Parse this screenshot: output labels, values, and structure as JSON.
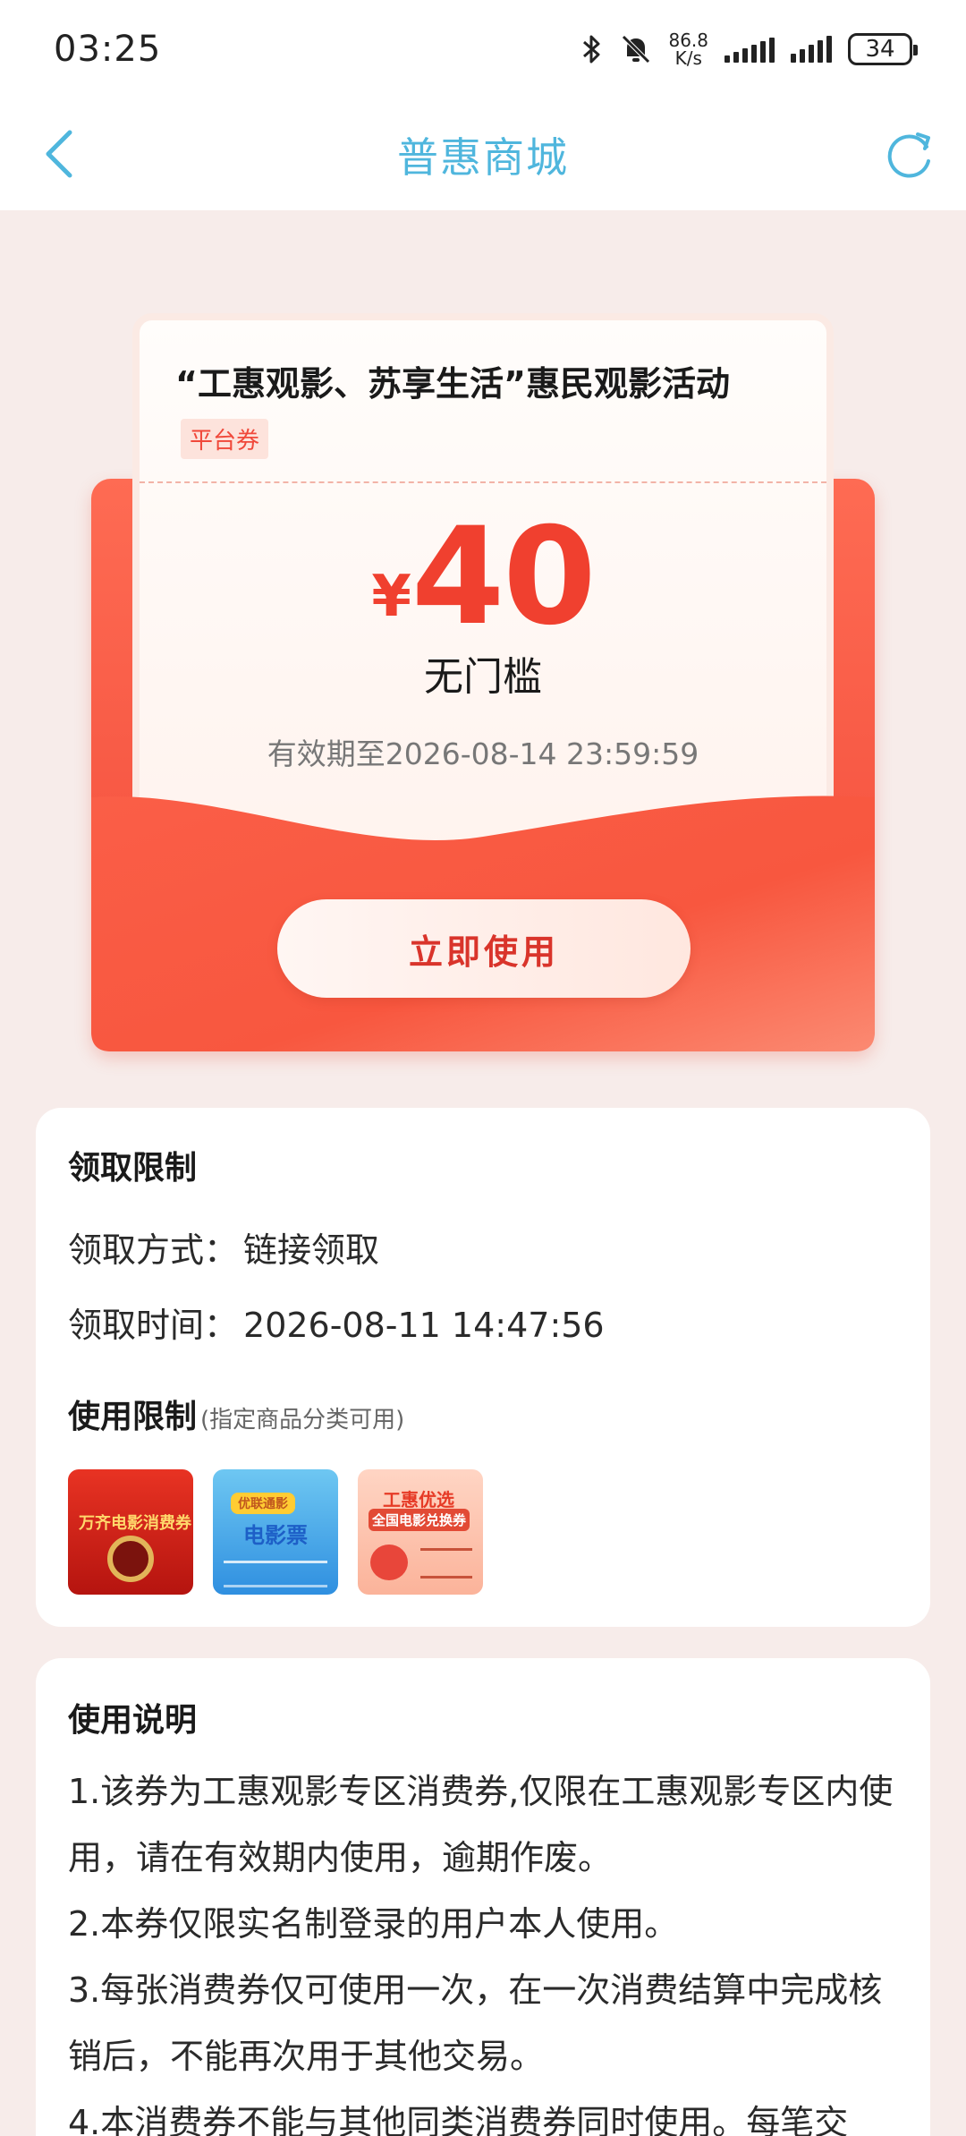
{
  "status_bar": {
    "time": "03:25",
    "net_speed_value": "86.8",
    "net_speed_unit": "K/s",
    "battery": "34"
  },
  "nav": {
    "title": "普惠商城",
    "back_icon": "chevron-left-icon",
    "refresh_icon": "refresh-icon",
    "accent_color": "#4fb6dd"
  },
  "coupon": {
    "title": "“工惠观影、苏享生活”惠民观影活动",
    "tag": "平台券",
    "currency": "¥",
    "amount": "40",
    "threshold": "无门槛",
    "validity": "有效期至2026-08-14 23:59:59",
    "use_button": "立即使用",
    "accent_color": "#f0402f"
  },
  "receive_limits": {
    "title": "领取限制",
    "method_label": "领取方式：",
    "method_value": "链接领取",
    "time_label": "领取时间：",
    "time_value": "2026-08-11 14:47:56"
  },
  "usage_limits": {
    "title": "使用限制",
    "subtitle": "(指定商品分类可用)",
    "categories": [
      {
        "text": "万齐电影消费券",
        "icon": "film-reel-icon"
      },
      {
        "badge": "优联通影",
        "text": "电影票",
        "icon": "movie-ticket-icon"
      },
      {
        "title": "工惠优选",
        "subtitle": "全国电影兑换券",
        "icon": "camera-icon"
      }
    ]
  },
  "instructions": {
    "title": "使用说明",
    "paragraphs": [
      "1.该券为工惠观影专区消费券,仅限在工惠观影专区内使用，请在有效期内使用，逾期作废。",
      "2.本券仅限实名制登录的用户本人使用。",
      "3.每张消费券仅可使用一次，在一次消费结算中完成核销后，不能再次用于其他交易。",
      "4.本消费券不能与其他同类消费券同时使用。每笔交"
    ]
  }
}
